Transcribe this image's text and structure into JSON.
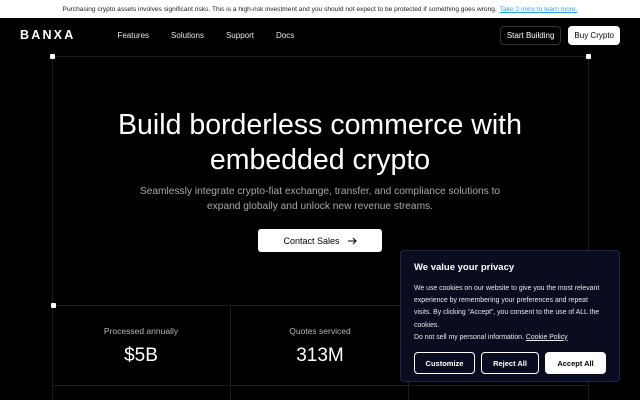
{
  "risk_banner": {
    "text": "Purchasing crypto assets involves significant risks. This is a high-risk investment and you should not expect to be protected if something goes wrong.",
    "link_text": "Take 2 mins to learn more."
  },
  "nav": {
    "logo": "BANXA",
    "links": [
      "Features",
      "Solutions",
      "Support",
      "Docs"
    ],
    "start_building": "Start Building",
    "buy_crypto": "Buy Crypto"
  },
  "hero": {
    "title_line1": "Build borderless commerce with",
    "title_line2": "embedded crypto",
    "subtitle_line1": "Seamlessly integrate crypto-fiat exchange, transfer, and compliance solutions to",
    "subtitle_line2": "expand globally and unlock new revenue streams.",
    "cta": "Contact Sales"
  },
  "stats": [
    {
      "label": "Processed annually",
      "value": "$5B"
    },
    {
      "label": "Quotes serviced",
      "value": "313M"
    }
  ],
  "cookie": {
    "title": "We value your privacy",
    "body": "We use cookies on our website to give you the most relevant experience by remembering your preferences and repeat visits. By clicking “Accept”, you consent to the use of ALL the cookies.",
    "do_not_sell": "Do not sell my personal information.",
    "policy_link": "Cookie Policy",
    "customize": "Customize",
    "reject": "Reject All",
    "accept": "Accept All"
  },
  "colors": {
    "background": "#000000",
    "link": "#2aa7e8",
    "cookie_bg": "#0a0c1f"
  }
}
